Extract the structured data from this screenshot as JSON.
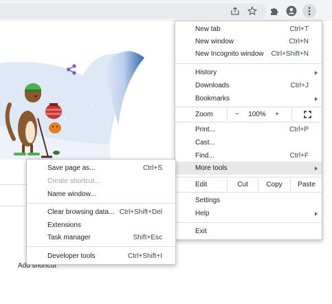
{
  "toolbar": {
    "icons": [
      "share-icon",
      "star-icon",
      "extensions-icon",
      "profile-icon",
      "kebab-menu-icon"
    ]
  },
  "page": {
    "add_shortcut": "Add shortcut"
  },
  "main_menu": {
    "new_tab": {
      "label": "New tab",
      "shortcut": "Ctrl+T"
    },
    "new_window": {
      "label": "New window",
      "shortcut": "Ctrl+N"
    },
    "new_incognito": {
      "label": "New Incognito window",
      "shortcut": "Ctrl+Shift+N"
    },
    "history": {
      "label": "History"
    },
    "downloads": {
      "label": "Downloads",
      "shortcut": "Ctrl+J"
    },
    "bookmarks": {
      "label": "Bookmarks"
    },
    "zoom": {
      "label": "Zoom",
      "minus": "−",
      "level": "100%",
      "plus": "+"
    },
    "print": {
      "label": "Print...",
      "shortcut": "Ctrl+P"
    },
    "cast": {
      "label": "Cast..."
    },
    "find": {
      "label": "Find...",
      "shortcut": "Ctrl+F"
    },
    "more_tools": {
      "label": "More tools"
    },
    "edit": {
      "label": "Edit",
      "cut": "Cut",
      "copy": "Copy",
      "paste": "Paste"
    },
    "settings": {
      "label": "Settings"
    },
    "help": {
      "label": "Help"
    },
    "exit": {
      "label": "Exit"
    }
  },
  "sub_menu": {
    "save_page": {
      "label": "Save page as...",
      "shortcut": "Ctrl+S"
    },
    "create_shortcut": {
      "label": "Create shortcut..."
    },
    "name_window": {
      "label": "Name window..."
    },
    "clear_browsing": {
      "label": "Clear browsing data...",
      "shortcut": "Ctrl+Shift+Del"
    },
    "extensions": {
      "label": "Extensions"
    },
    "task_manager": {
      "label": "Task manager",
      "shortcut": "Shift+Esc"
    },
    "developer_tools": {
      "label": "Developer tools",
      "shortcut": "Ctrl+Shift+I"
    }
  },
  "colors": {
    "menu_highlight": "#e8e8e8",
    "doodle_sky": "#dfe7f7",
    "doodle_wave": "#3d6fb6",
    "share_accent": "#7d5cc4"
  }
}
